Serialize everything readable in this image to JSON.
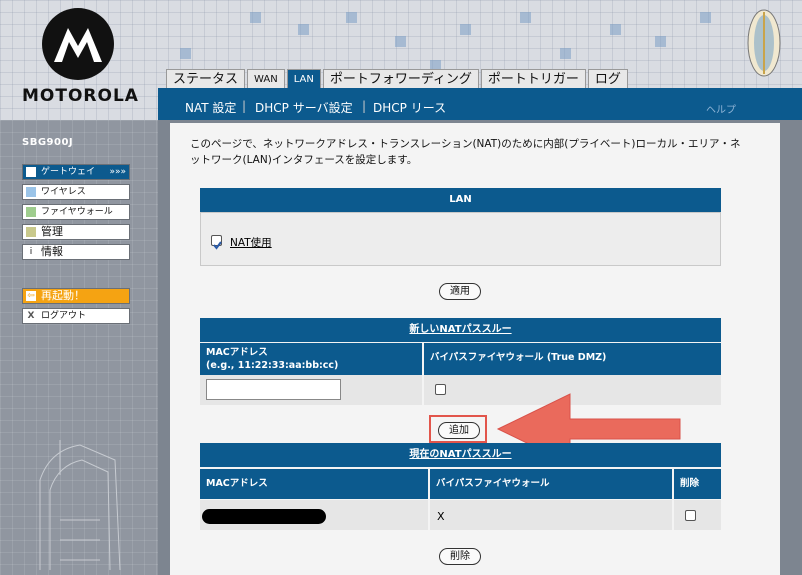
{
  "brand": "MOTOROLA",
  "model": "SBG900J",
  "tabs": [
    {
      "label": "ステータス"
    },
    {
      "label": "WAN"
    },
    {
      "label": "LAN",
      "active": true
    },
    {
      "label": "ポートフォワーディング"
    },
    {
      "label": "ポートトリガー"
    },
    {
      "label": "ログ"
    }
  ],
  "subnav": {
    "nat": "NAT 設定",
    "dhcp_server": "DHCP サーバ設定",
    "dhcp_lease": "DHCP リース",
    "help": "ヘルプ"
  },
  "sidebar": {
    "items": [
      {
        "label": "ゲートウェイ",
        "icon_color": "#0c5a8e",
        "suffix": "»»»"
      },
      {
        "label": "ワイヤレス",
        "icon_color": "#9bc4e8"
      },
      {
        "label": "ファイヤウォール",
        "icon_color": "#9fcd8e"
      },
      {
        "label": "管理",
        "icon_color": "#c9c98c"
      },
      {
        "label": "情報",
        "icon_glyph": "i"
      },
      {
        "label": "再起動！",
        "icon_glyph": "⇦"
      },
      {
        "label": "ログアウト",
        "icon_glyph": "X"
      }
    ]
  },
  "intro": "このページで、ネットワークアドレス・トランスレーション(NAT)のために内部(プライベート)ローカル・エリア・ネットワーク(LAN)インタフェースを設定します。",
  "lan": {
    "header": "LAN",
    "nat_checkbox_label": "NAT使用",
    "nat_checked": true,
    "apply_button": "適用"
  },
  "new_passthrough": {
    "header": "新しいNATパススルー",
    "col_mac": "MACアドレス",
    "col_mac_example": "(e.g., 11:22:33:aa:bb:cc)",
    "col_bypass": "バイパスファイヤウォール (True DMZ)",
    "mac_value": "",
    "add_button": "追加"
  },
  "current_passthrough": {
    "header": "現在のNATパススルー",
    "col_mac": "MACアドレス",
    "col_bypass": "バイパスファイヤウォール",
    "col_delete": "削除",
    "rows": [
      {
        "mac": "",
        "bypass": "X"
      }
    ],
    "delete_button": "削除"
  },
  "colors": {
    "header_blue": "#0c5a8e",
    "highlight_red": "#e2554b",
    "restart_orange": "#f5a312"
  }
}
